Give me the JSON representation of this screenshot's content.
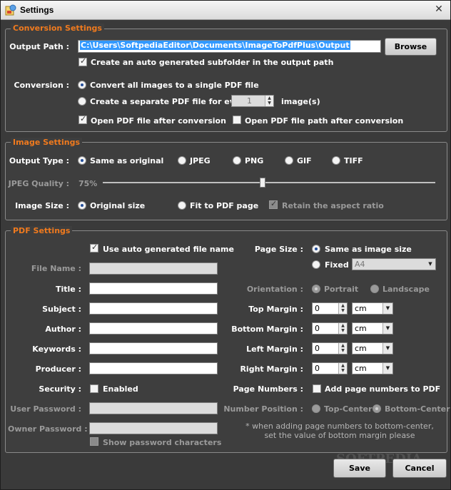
{
  "window": {
    "title": "Settings"
  },
  "conversion": {
    "legend": "Conversion Settings",
    "output_path_label": "Output Path :",
    "output_path": "C:\\Users\\SoftpediaEditor\\Documents\\ImageToPdfPlus\\Output",
    "browse": "Browse",
    "auto_subfolder": "Create an auto generated subfolder in the output path",
    "conversion_label": "Conversion :",
    "single_pdf": "Convert all images to a single PDF file",
    "separate_pdf": "Create a separate PDF file for every",
    "every_value": "1",
    "images_suffix": "image(s)",
    "open_pdf": "Open PDF file after conversion",
    "open_path": "Open PDF file path after conversion"
  },
  "image": {
    "legend": "Image Settings",
    "output_type_label": "Output Type :",
    "types": [
      "Same as original",
      "JPEG",
      "PNG",
      "GIF",
      "TIFF"
    ],
    "jpeg_quality_label": "JPEG Quality :",
    "jpeg_quality": "75%",
    "jpeg_quality_fraction": 0.75,
    "image_size_label": "Image Size :",
    "original_size": "Original size",
    "fit_page": "Fit to PDF page",
    "retain_ratio": "Retain the aspect ratio"
  },
  "pdf": {
    "legend": "PDF Settings",
    "auto_name": "Use auto generated file name",
    "file_name_label": "File Name :",
    "title_label": "Title :",
    "subject_label": "Subject :",
    "author_label": "Author :",
    "keywords_label": "Keywords :",
    "producer_label": "Producer :",
    "security_label": "Security :",
    "enabled": "Enabled",
    "user_password_label": "User Password :",
    "owner_password_label": "Owner Password :",
    "show_password": "Show password characters",
    "page_size_label": "Page Size :",
    "same_as_image": "Same as image size",
    "fixed": "Fixed",
    "fixed_value": "A4",
    "orientation_label": "Orientation :",
    "portrait": "Portrait",
    "landscape": "Landscape",
    "top_margin_label": "Top Margin :",
    "bottom_margin_label": "Bottom Margin :",
    "left_margin_label": "Left Margin :",
    "right_margin_label": "Right Margin :",
    "margin_value": "0",
    "unit": "cm",
    "page_numbers_label": "Page Numbers :",
    "add_page_numbers": "Add page numbers to PDF",
    "number_position_label": "Number Position :",
    "top_center": "Top-Center",
    "bottom_center": "Bottom-Center",
    "note_line1": "* when adding page numbers to bottom-center,",
    "note_line2": "set the value of bottom margin please"
  },
  "footer": {
    "save": "Save",
    "cancel": "Cancel",
    "watermark": "SOFTPEDIA"
  },
  "colors": {
    "accent": "#f07a1e",
    "background": "#3a3a3a",
    "selection": "#3399ff"
  }
}
